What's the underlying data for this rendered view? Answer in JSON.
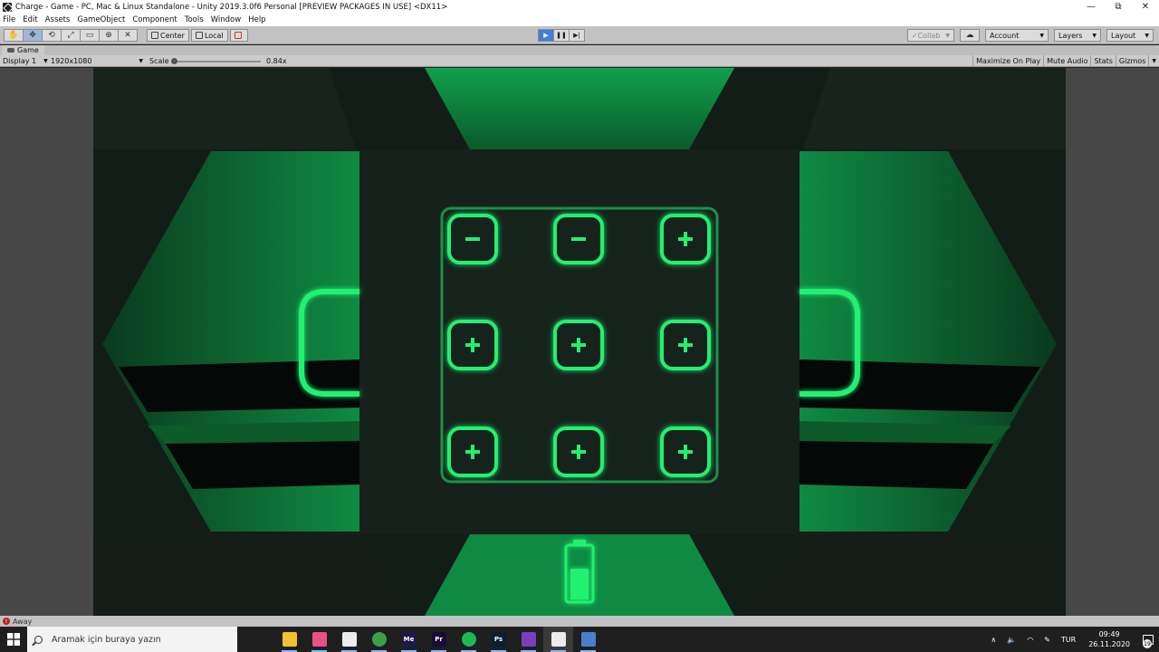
{
  "window": {
    "title": "Charge - Game - PC, Mac & Linux Standalone - Unity 2019.3.0f6 Personal [PREVIEW PACKAGES IN USE] <DX11>",
    "controls": {
      "minimize": "—",
      "maximize": "⧉",
      "close": "✕"
    }
  },
  "menu": [
    "File",
    "Edit",
    "Assets",
    "GameObject",
    "Component",
    "Tools",
    "Window",
    "Help"
  ],
  "toolbar": {
    "tools": [
      "hand-icon",
      "move-icon",
      "rotate-icon",
      "scale-icon",
      "rect-icon",
      "transform-icon",
      "custom-tool-icon"
    ],
    "pivot_center": "Center",
    "pivot_local": "Local",
    "collab": "Collab",
    "account": "Account",
    "layers": "Layers",
    "layout": "Layout"
  },
  "game_tab": {
    "label": "Game"
  },
  "game_bar": {
    "display": "Display 1",
    "resolution": "1920x1080",
    "scale_label": "Scale",
    "scale_value": "0.84x",
    "scale_fraction": 0.0,
    "maximize_on_play": "Maximize On Play",
    "mute_audio": "Mute Audio",
    "stats": "Stats",
    "gizmos": "Gizmos"
  },
  "game": {
    "accent": "#20f070",
    "grid": [
      [
        "minus",
        "minus",
        "plus"
      ],
      [
        "plus",
        "plus",
        "plus"
      ],
      [
        "plus",
        "plus",
        "plus"
      ]
    ],
    "battery_level": 0.6
  },
  "status": {
    "message": "Away",
    "error_color": "#c81c1c"
  },
  "taskbar": {
    "search_placeholder": "Aramak için buraya yazın",
    "apps": [
      {
        "name": "task-view-icon",
        "label": "",
        "color": "#1f1f1f"
      },
      {
        "name": "file-explorer-icon",
        "label": "",
        "color": "#f2c12e"
      },
      {
        "name": "photos-icon",
        "label": "",
        "color": "#e8508a"
      },
      {
        "name": "unity-hub-icon",
        "label": "",
        "color": "#ececec"
      },
      {
        "name": "chrome-icon",
        "label": "",
        "color": "#3b9f4a"
      },
      {
        "name": "media-encoder-icon",
        "label": "Me",
        "color": "#1d1a4a"
      },
      {
        "name": "premiere-icon",
        "label": "Pr",
        "color": "#1a0a38"
      },
      {
        "name": "spotify-icon",
        "label": "",
        "color": "#1db954"
      },
      {
        "name": "photoshop-icon",
        "label": "Ps",
        "color": "#0a1d33"
      },
      {
        "name": "visual-studio-icon",
        "label": "",
        "color": "#7a3fbf"
      },
      {
        "name": "unity-icon",
        "label": "",
        "color": "#ececec"
      },
      {
        "name": "paint-icon",
        "label": "",
        "color": "#4a7fd0"
      }
    ],
    "language": "TUR",
    "time": "09:49",
    "date": "26.11.2020",
    "notification_count": "19"
  }
}
